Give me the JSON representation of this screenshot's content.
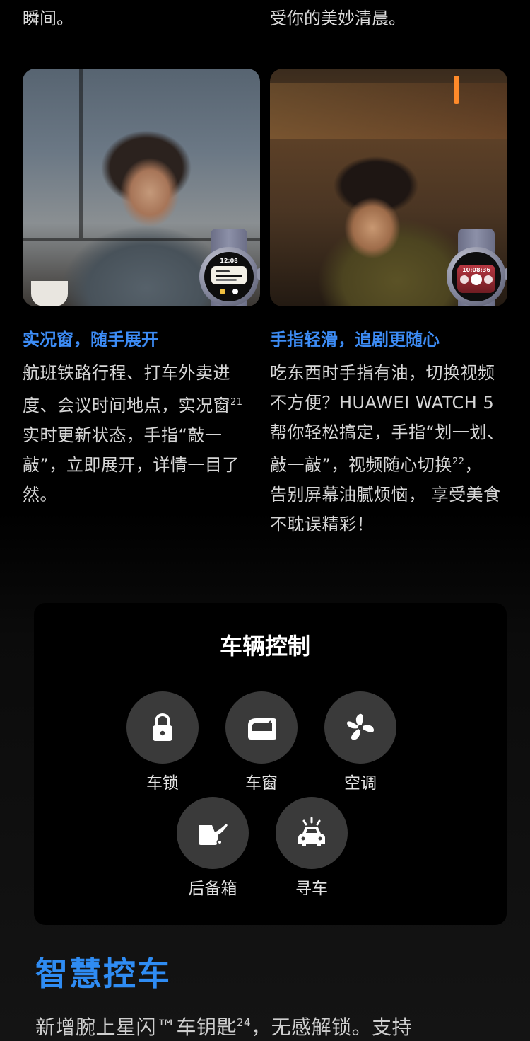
{
  "top_text": {
    "left": "瞬间。",
    "right": "受你的美妙清晨。"
  },
  "card_left": {
    "watch_time": "12:08",
    "title": "实况窗，随手展开",
    "desc_lines": [
      "航班铁路行程、打车外卖进",
      "度、会议时间地点，实况窗",
      "实时更新状态，手指“敲一",
      "敲”，立即展开，详情一目了",
      "然。"
    ],
    "footnote": "21"
  },
  "card_right": {
    "watch_time": "10:08:36",
    "title": "手指轻滑，追剧更随心",
    "desc_lines": [
      "吃东西时手指有油，切换视频",
      "不方便？HUAWEI WATCH 5",
      "帮你轻松搞定，手指“划一划、",
      "敲一敲”，视频随心切换",
      "告别屏幕油腻烦恼， 享受美食",
      "不耽误精彩！"
    ],
    "footnote": "22"
  },
  "vehicle_panel": {
    "title": "车辆控制",
    "controls": [
      {
        "label": "车锁",
        "icon": "lock-icon"
      },
      {
        "label": "车窗",
        "icon": "car-window-icon"
      },
      {
        "label": "空调",
        "icon": "fan-icon"
      },
      {
        "label": "后备箱",
        "icon": "trunk-icon"
      },
      {
        "label": "寻车",
        "icon": "find-car-icon"
      }
    ]
  },
  "section": {
    "title": "智慧控车",
    "desc_before": "新增腕上星闪™车钥匙",
    "footnote": "24",
    "desc_after": "，无感解锁。支持"
  },
  "colors": {
    "accent_blue": "#3d8cf5",
    "panel_bg": "#000000",
    "control_circle": "#3a3a3a"
  }
}
